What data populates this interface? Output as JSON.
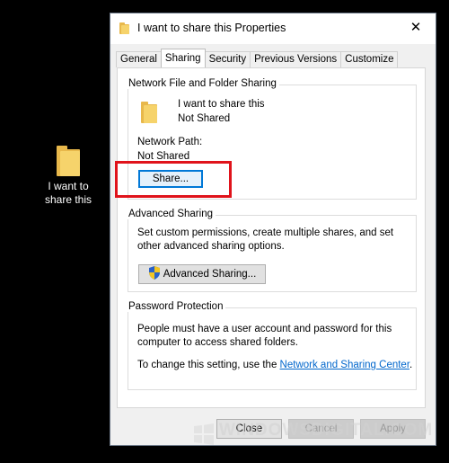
{
  "desktop": {
    "icon_label": "I want to\nshare this"
  },
  "window": {
    "title": "I want to share this Properties",
    "close_glyph": "✕"
  },
  "tabs": [
    {
      "label": "General",
      "active": false
    },
    {
      "label": "Sharing",
      "active": true
    },
    {
      "label": "Security",
      "active": false
    },
    {
      "label": "Previous Versions",
      "active": false
    },
    {
      "label": "Customize",
      "active": false
    }
  ],
  "network_sharing": {
    "group_title": "Network File and Folder Sharing",
    "folder_name": "I want to share this",
    "share_status": "Not Shared",
    "path_label": "Network Path:",
    "path_value": "Not Shared",
    "share_button": "Share..."
  },
  "advanced_sharing": {
    "group_title": "Advanced Sharing",
    "description": "Set custom permissions, create multiple shares, and set other advanced sharing options.",
    "button": "Advanced Sharing..."
  },
  "password_protection": {
    "group_title": "Password Protection",
    "description": "People must have a user account and password for this computer to access shared folders.",
    "change_prefix": "To change this setting, use the ",
    "link_text": "Network and Sharing Center",
    "change_suffix": "."
  },
  "footer": {
    "close": "Close",
    "cancel": "Cancel",
    "apply": "Apply"
  },
  "watermark": "WINDOWSDIGITAL.COM",
  "colors": {
    "highlight": "#e0131b",
    "link": "#0066cc",
    "folder": "#f6d36b",
    "focus": "#0078d7"
  }
}
